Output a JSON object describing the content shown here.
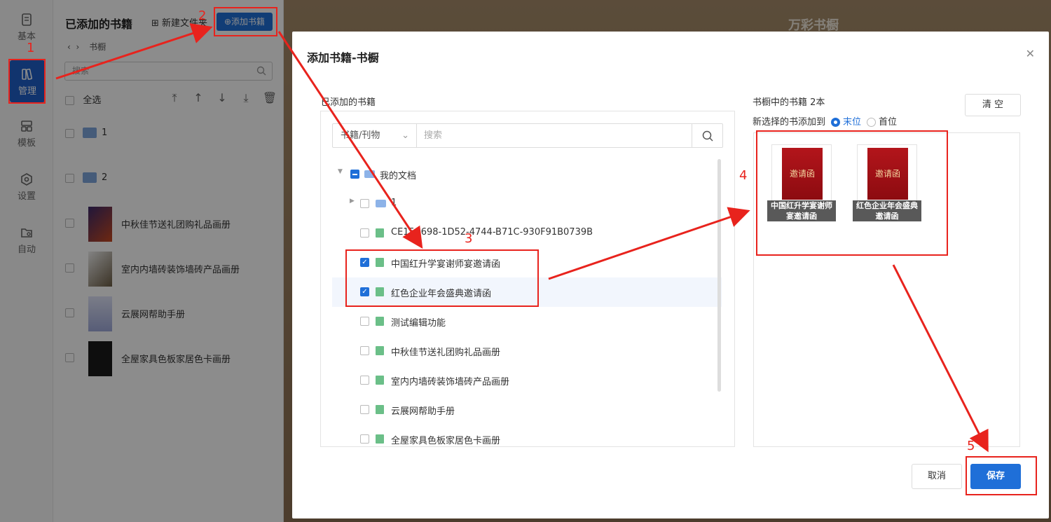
{
  "rail": {
    "items": [
      {
        "label": "基本",
        "icon": "file-icon"
      },
      {
        "label": "管理",
        "icon": "books-icon"
      },
      {
        "label": "模板",
        "icon": "template-icon"
      },
      {
        "label": "设置",
        "icon": "gear-icon"
      },
      {
        "label": "自动",
        "icon": "auto-folder-icon"
      }
    ]
  },
  "panel": {
    "title": "已添加的书籍",
    "new_folder": "新建文件夹",
    "add_book": "添加书籍",
    "crumb": "书橱",
    "search_placeholder": "搜索",
    "select_all": "全选",
    "rows": [
      {
        "label": "1",
        "kind": "folder"
      },
      {
        "label": "2",
        "kind": "folder"
      },
      {
        "label": "中秋佳节送礼团购礼品画册",
        "kind": "book"
      },
      {
        "label": "室内内墙砖装饰墙砖产品画册",
        "kind": "book"
      },
      {
        "label": "云展网帮助手册",
        "kind": "book"
      },
      {
        "label": "全屋家具色板家居色卡画册",
        "kind": "book"
      }
    ]
  },
  "stage": {
    "title": "万彩书橱"
  },
  "dialog": {
    "title": "添加书籍-书橱",
    "left_header": "已添加的书籍",
    "filter_select": "书籍/刊物",
    "filter_placeholder": "搜索",
    "tree": [
      {
        "label": "我的文档",
        "state": "indeterminate",
        "type": "folder",
        "level": 0
      },
      {
        "label": "1",
        "state": "unchecked",
        "type": "folder",
        "level": 1
      },
      {
        "label": "CE15A698-1D52-4744-B71C-930F91B0739B",
        "state": "unchecked",
        "type": "book",
        "level": 1
      },
      {
        "label": "中国红升学宴谢师宴邀请函",
        "state": "checked",
        "type": "book",
        "level": 1
      },
      {
        "label": "红色企业年会盛典邀请函",
        "state": "checked",
        "type": "book",
        "level": 1
      },
      {
        "label": "测试编辑功能",
        "state": "unchecked",
        "type": "book",
        "level": 1
      },
      {
        "label": "中秋佳节送礼团购礼品画册",
        "state": "unchecked",
        "type": "book",
        "level": 1
      },
      {
        "label": "室内内墙砖装饰墙砖产品画册",
        "state": "unchecked",
        "type": "book",
        "level": 1
      },
      {
        "label": "云展网帮助手册",
        "state": "unchecked",
        "type": "book",
        "level": 1
      },
      {
        "label": "全屋家具色板家居色卡画册",
        "state": "unchecked",
        "type": "book",
        "level": 1
      }
    ],
    "right_header": "书橱中的书籍 2本",
    "insert_label": "新选择的书添加到",
    "insert_options": [
      "末位",
      "首位"
    ],
    "clear": "清 空",
    "shelf_books": [
      {
        "caption": "中国红升学宴谢师宴邀请函",
        "cover_text": "邀请函"
      },
      {
        "caption": "红色企业年会盛典邀请函",
        "cover_text": "邀请函"
      }
    ],
    "cancel": "取消",
    "save": "保存"
  },
  "annotations": [
    "1",
    "2",
    "3",
    "4",
    "5"
  ],
  "colors": {
    "accent": "#1f6fd8",
    "annotation": "#e8231d"
  }
}
